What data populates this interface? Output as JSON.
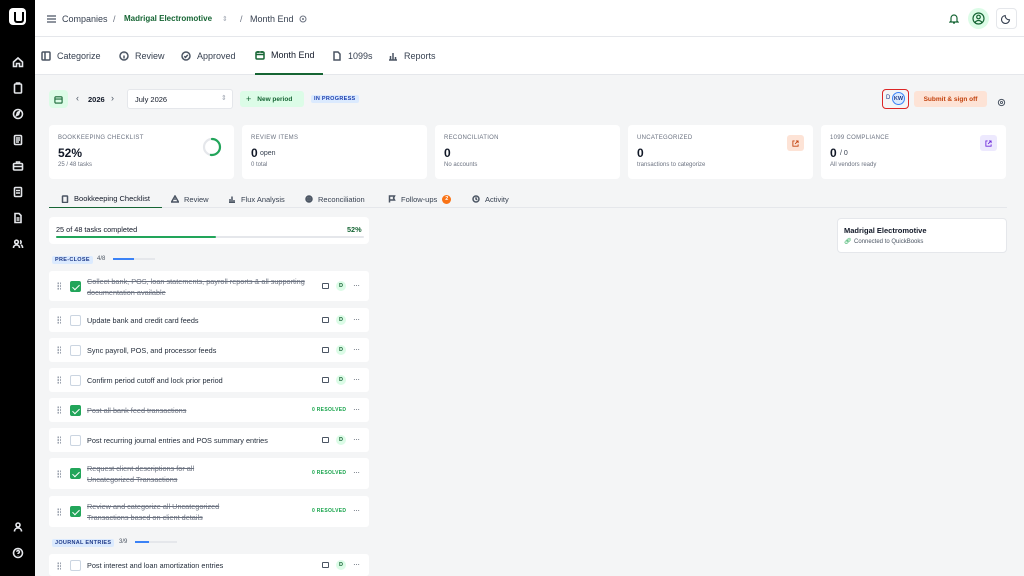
{
  "nav": {
    "breadcrumb": {
      "companies": "Companies",
      "sep": "/",
      "company": "Madrigal Electromotive",
      "sep2": "/",
      "page": "Month End"
    }
  },
  "tabs": [
    {
      "label": "Categorize",
      "icon": "categorize-icon"
    },
    {
      "label": "Review",
      "icon": "info-icon"
    },
    {
      "label": "Approved",
      "icon": "check-circle-icon"
    },
    {
      "label": "Month End",
      "icon": "calendar-icon"
    },
    {
      "label": "1099s",
      "icon": "document-icon"
    },
    {
      "label": "Reports",
      "icon": "bar-chart-icon"
    }
  ],
  "period": {
    "year": "2026",
    "month_value": "July 2026",
    "new_period": "New period",
    "status": "IN PROGRESS",
    "avatar_d": "D",
    "avatar_kw": "KW",
    "submit": "Submit & sign off"
  },
  "stats": {
    "checklist": {
      "label": "BOOKKEEPING CHECKLIST",
      "value": "52%",
      "sub": "25 / 48 tasks"
    },
    "review": {
      "label": "REVIEW ITEMS",
      "value": "0",
      "unit": "open",
      "sub": "0 total"
    },
    "recon": {
      "label": "RECONCILIATION",
      "value": "0",
      "sub": "No accounts"
    },
    "uncat": {
      "label": "UNCATEGORIZED",
      "value": "0",
      "sub": "transactions to categorize"
    },
    "c1099": {
      "label": "1099 COMPLIANCE",
      "value": "0",
      "unit": "/ 0",
      "sub": "All vendors ready"
    }
  },
  "subtabs": [
    {
      "label": "Bookkeeping Checklist"
    },
    {
      "label": "Review"
    },
    {
      "label": "Flux Analysis"
    },
    {
      "label": "Reconciliation"
    },
    {
      "label": "Follow-ups",
      "badge": "2"
    },
    {
      "label": "Activity"
    }
  ],
  "progress": {
    "label": "25 of 48 tasks completed",
    "pct_label": "52%",
    "fraction": 0.52
  },
  "sections": [
    {
      "name": "PRE-CLOSE",
      "count": "4/8",
      "fraction": 0.5
    },
    {
      "name": "JOURNAL ENTRIES",
      "count": "3/9",
      "fraction": 0.33
    }
  ],
  "tasks": [
    {
      "text": "Collect bank, POS, loan statements, payroll reports & all supporting documentation available",
      "done": true
    },
    {
      "text": "Update bank and credit card feeds",
      "done": false
    },
    {
      "text": "Sync payroll, POS, and processor feeds",
      "done": false
    },
    {
      "text": "Confirm period cutoff and lock prior period",
      "done": false
    },
    {
      "text": "Post all bank feed transactions",
      "done": true,
      "resolved": "0 RESOLVED"
    },
    {
      "text": "Post recurring journal entries and POS summary entries",
      "done": false
    },
    {
      "text": "Request client descriptions for all Uncategorized Transactions",
      "done": true,
      "resolved": "0 RESOLVED"
    },
    {
      "text": "Review and categorize all Uncategorized Transactions based on client details",
      "done": true,
      "resolved": "0 RESOLVED"
    },
    {
      "text": "Post interest and loan amortization entries",
      "done": false
    }
  ],
  "task_badge": "D",
  "task_more": "···",
  "company_card": {
    "name": "Madrigal Electromotive",
    "status": "Connected to QuickBooks"
  },
  "colors": {
    "brand_green": "#166534",
    "check_green": "#22a55a",
    "progress_blue": "#3b82f6",
    "submit_bg": "#fde3d6"
  }
}
